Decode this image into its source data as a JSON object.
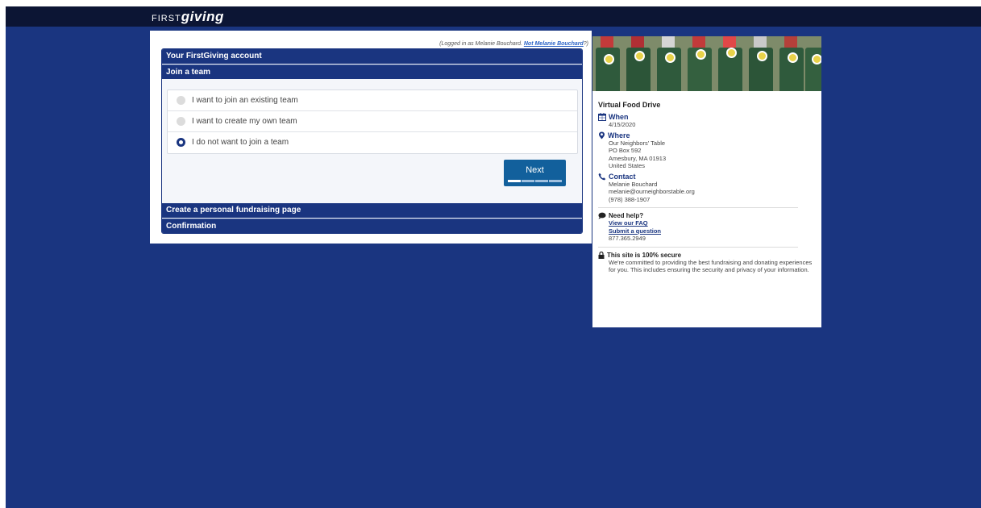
{
  "header": {
    "logo_first": "FIRST",
    "logo_giving": "giving"
  },
  "account": {
    "logged_prefix": "(Logged in as Melanie Bouchard.",
    "not_link": "Not Melanie Bouchard",
    "logged_suffix": "?)"
  },
  "steps": {
    "account_title": "Your FirstGiving account",
    "join_title": "Join a team",
    "options": [
      {
        "label": "I want to join an existing team",
        "selected": false
      },
      {
        "label": "I want to create my own team",
        "selected": false
      },
      {
        "label": "I do not want to join a team",
        "selected": true
      }
    ],
    "next_label": "Next",
    "progress": {
      "completed_steps": 1,
      "total_steps": 4
    },
    "personal_page_title": "Create a personal fundraising page",
    "confirmation_title": "Confirmation"
  },
  "event": {
    "title": "Virtual Food Drive",
    "when_label": "When",
    "when_value": "4/15/2020",
    "where_label": "Where",
    "where_lines": [
      "Our Neighbors' Table",
      "PO Box 592",
      "Amesbury, MA 01913",
      "United States"
    ],
    "contact_label": "Contact",
    "contact_lines": [
      "Melanie Bouchard",
      "melanie@ourneighborstable.org",
      "(978) 388-1907"
    ]
  },
  "help": {
    "title": "Need help?",
    "faq_link": "View our FAQ",
    "question_link": "Submit a question",
    "phone": "877.365.2949"
  },
  "secure": {
    "title": "This site is 100% secure",
    "text": "We're committed to providing the best fundraising and donating experiences for you. This includes ensuring the security and privacy of your information."
  },
  "colors": {
    "page_bg": "#1a3580",
    "topbar": "#0c1534",
    "button": "#12609c",
    "accent": "#1a3580"
  }
}
